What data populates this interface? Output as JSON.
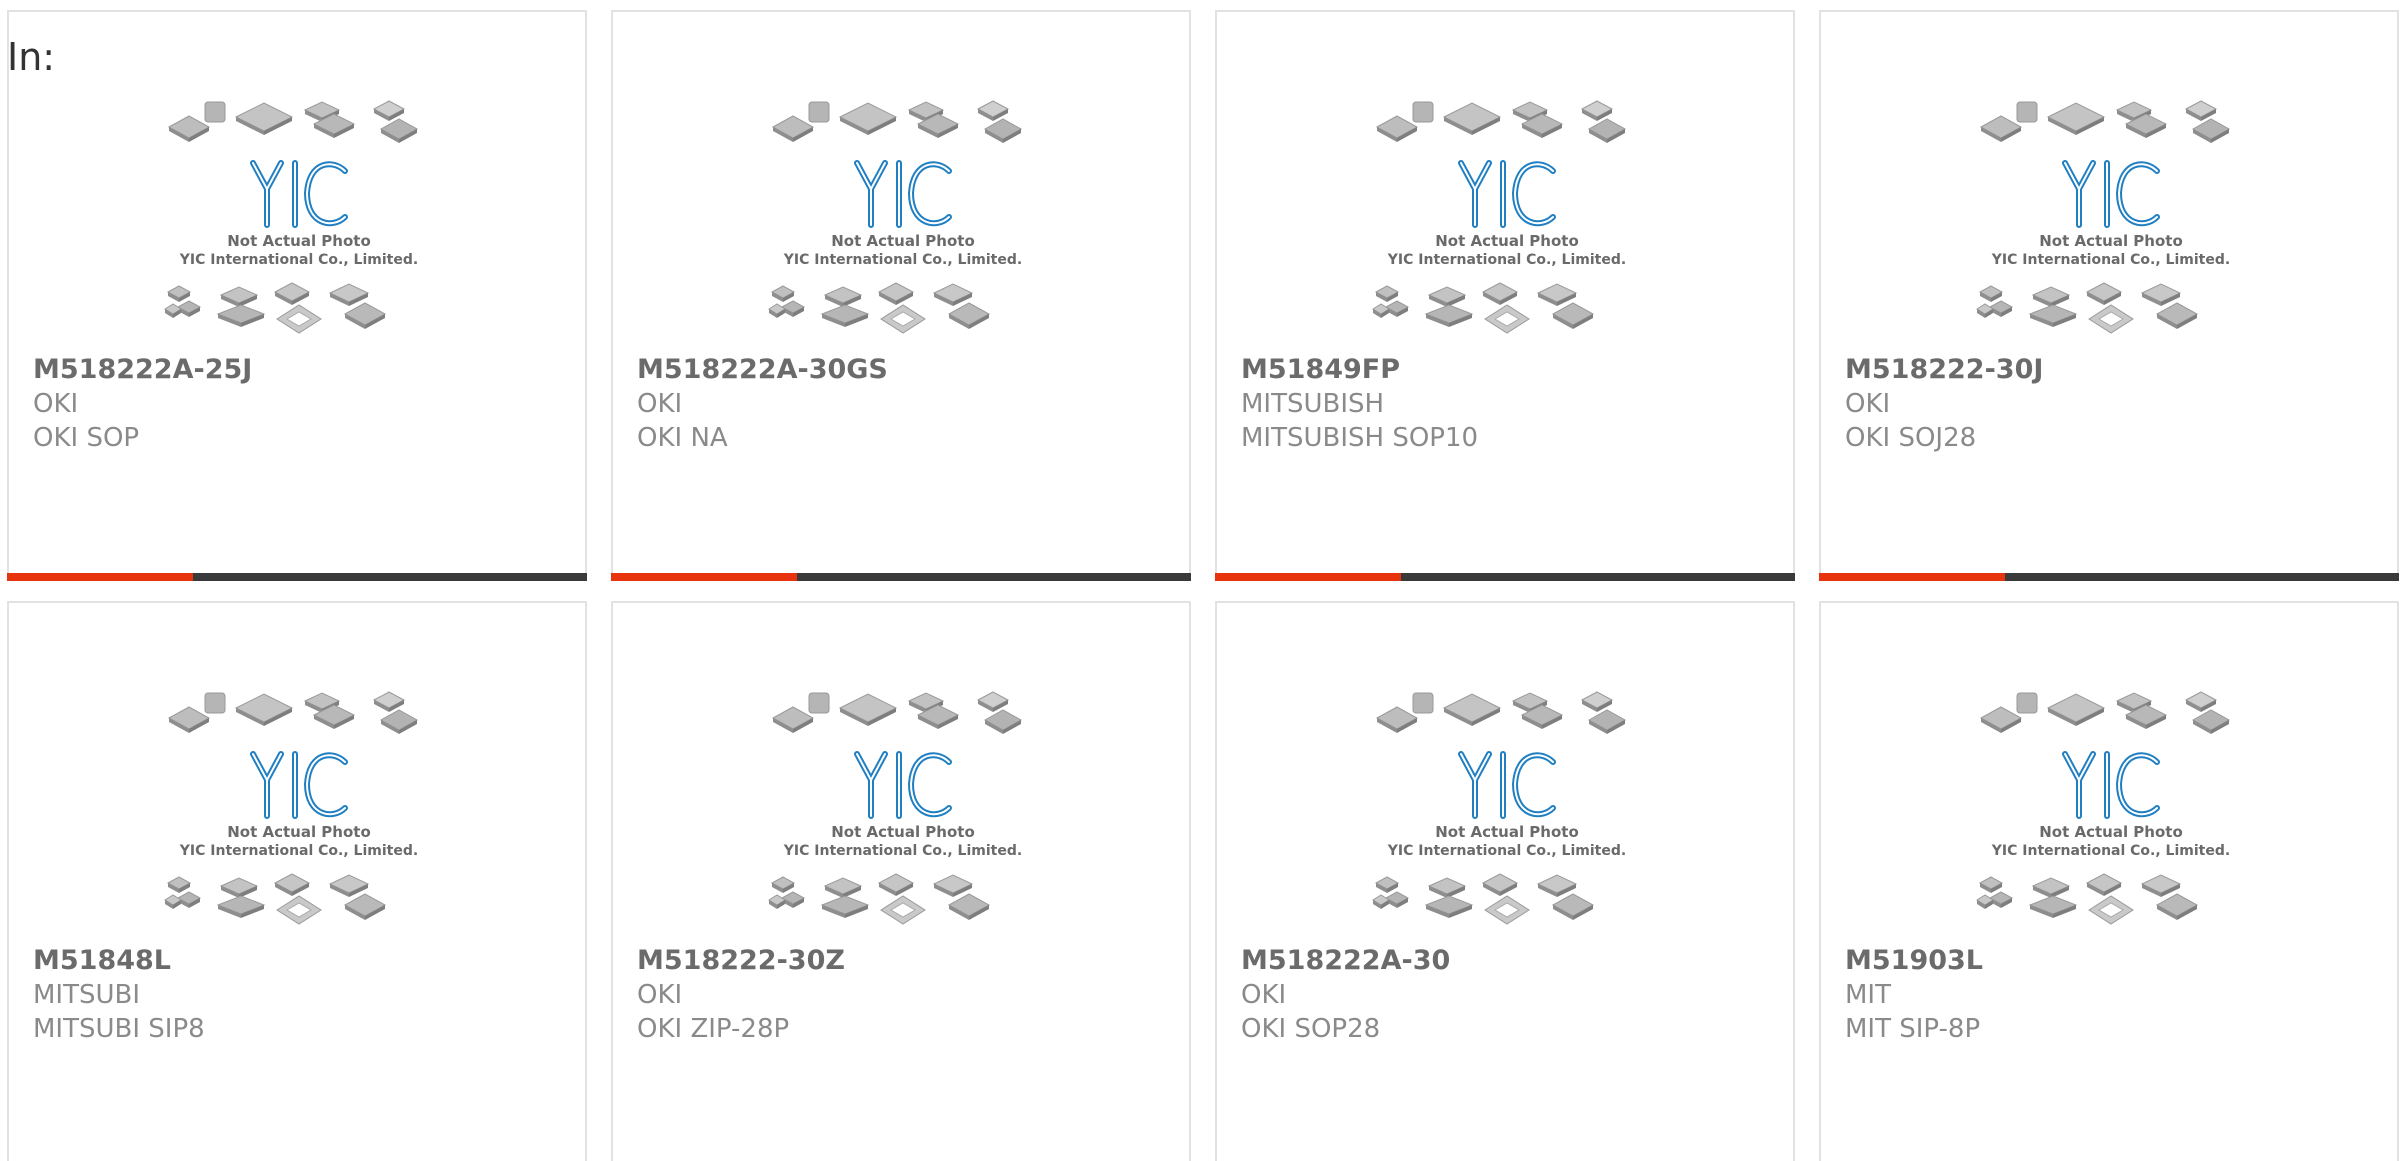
{
  "header": {
    "label": "In:"
  },
  "placeholder": {
    "line1": "Not Actual Photo",
    "line2": "YIC International Co., Limited."
  },
  "colors": {
    "progress_fill": "#e8330f",
    "progress_track": "#3a3a3a",
    "logo_blue": "#1f7fc2"
  },
  "products": [
    {
      "part": "M518222A-25J",
      "manufacturer": "OKI",
      "package": "OKI SOP",
      "progress": 0.32
    },
    {
      "part": "M518222A-30GS",
      "manufacturer": "OKI",
      "package": "OKI NA",
      "progress": 0.32
    },
    {
      "part": "M51849FP",
      "manufacturer": "MITSUBISH",
      "package": "MITSUBISH SOP10",
      "progress": 0.32
    },
    {
      "part": "M518222-30J",
      "manufacturer": "OKI",
      "package": "OKI SOJ28",
      "progress": 0.32
    },
    {
      "part": "M51848L",
      "manufacturer": "MITSUBI",
      "package": "MITSUBI SIP8"
    },
    {
      "part": "M518222-30Z",
      "manufacturer": "OKI",
      "package": "OKI ZIP-28P"
    },
    {
      "part": "M518222A-30",
      "manufacturer": "OKI",
      "package": "OKI SOP28"
    },
    {
      "part": "M51903L",
      "manufacturer": "MIT",
      "package": "MIT SIP-8P"
    }
  ]
}
